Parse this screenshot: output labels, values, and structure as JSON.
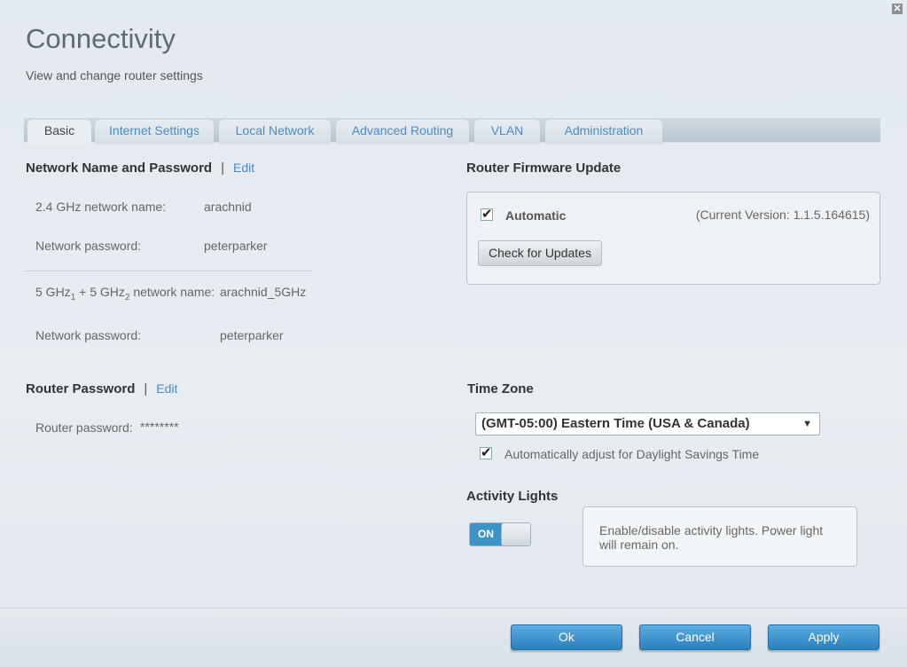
{
  "header": {
    "title": "Connectivity",
    "subtitle": "View and change router settings"
  },
  "tabs": [
    {
      "label": "Basic"
    },
    {
      "label": "Internet Settings"
    },
    {
      "label": "Local Network"
    },
    {
      "label": "Advanced Routing"
    },
    {
      "label": "VLAN"
    },
    {
      "label": "Administration"
    }
  ],
  "network": {
    "heading": "Network Name and Password",
    "edit": "Edit",
    "sep": "|",
    "name24_label": "2.4 GHz network name:",
    "name24_value": "arachnid",
    "pw24_label": "Network password:",
    "pw24_value": "peterparker",
    "name5_label_a": "5 GHz",
    "name5_sub1": "1",
    "name5_label_b": " + 5 GHz",
    "name5_sub2": "2",
    "name5_label_c": " network name:",
    "name5_value": "arachnid_5GHz",
    "pw5_label": "Network password:",
    "pw5_value": "peterparker"
  },
  "router_password": {
    "heading": "Router Password",
    "edit": "Edit",
    "sep": "|",
    "label": "Router password:",
    "value": "********"
  },
  "firmware": {
    "heading": "Router Firmware Update",
    "automatic_label": "Automatic",
    "automatic_checked": true,
    "current_version": "(Current Version: 1.1.5.164615)",
    "check_button": "Check for Updates"
  },
  "timezone": {
    "heading": "Time Zone",
    "selected": "(GMT-05:00) Eastern Time (USA & Canada)",
    "dst_label": "Automatically adjust for Daylight Savings Time",
    "dst_checked": true
  },
  "activity": {
    "heading": "Activity Lights",
    "toggle_label": "ON",
    "tip": "Enable/disable activity lights. Power light will remain on."
  },
  "footer": {
    "ok": "Ok",
    "cancel": "Cancel",
    "apply": "Apply"
  },
  "close_glyph": "✕"
}
